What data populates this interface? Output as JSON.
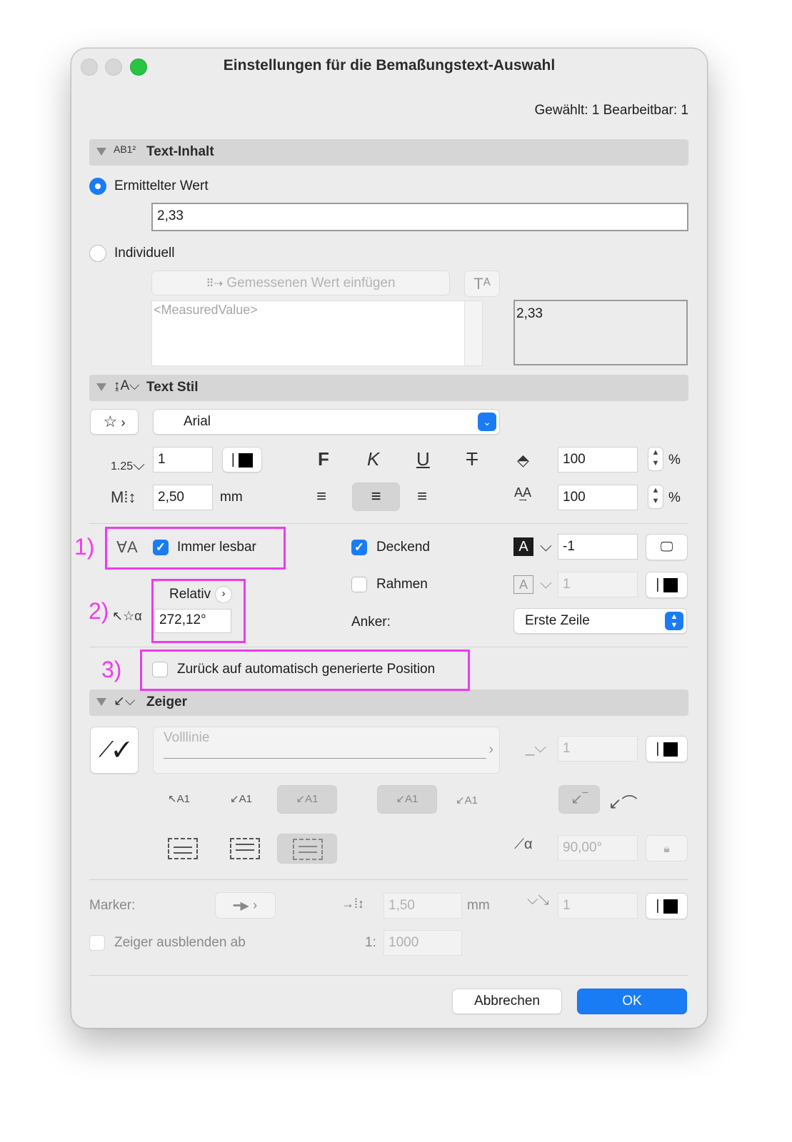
{
  "window": {
    "title": "Einstellungen für die Bemaßungstext-Auswahl",
    "status": "Gewählt: 1 Bearbeitbar: 1"
  },
  "text_inhalt": {
    "section_title": "Text-Inhalt",
    "icon_label": "AB1²",
    "option_measured": "Ermittelter Wert",
    "measured_value": "2,33",
    "option_custom": "Individuell",
    "insert_button": "Gemessenen Wert einfügen",
    "insert_button_icon": "⠿⇢",
    "text_button": "Tᴬ",
    "custom_placeholder": "<MeasuredValue>",
    "preview": "2,33"
  },
  "text_stil": {
    "section_title": "Text Stil",
    "font": "Arial",
    "pen_prefix": "1.25",
    "pen": "1",
    "size": "2,50",
    "size_unit": "mm",
    "bold": "F",
    "italic": "K",
    "underline": "U",
    "strike": "T",
    "width_pct": "100",
    "spacing_pct": "100",
    "pct": "%",
    "always_readable": "Immer lesbar",
    "opaque": "Deckend",
    "frame": "Rahmen",
    "background_pen": "-1",
    "frame_pen": "1",
    "relative": "Relativ",
    "angle": "272,12°",
    "anchor_label": "Anker:",
    "anchor_value": "Erste Zeile",
    "reset_position": "Zurück auf automatisch generierte Position",
    "marker_1": "1)",
    "marker_2": "2)",
    "marker_3": "3)"
  },
  "zeiger": {
    "section_title": "Zeiger",
    "line_type": "Volllinie",
    "pen": "1",
    "angle": "90,00°",
    "alpha": "α",
    "marker_label": "Marker:",
    "marker_size": "1,50",
    "marker_unit": "mm",
    "marker_pen": "1",
    "hide_label": "Zeiger ausblenden ab",
    "scale_prefix": "1:",
    "scale": "1000",
    "leader_a1": "A1"
  },
  "buttons": {
    "cancel": "Abbrechen",
    "ok": "OK"
  },
  "colors": {
    "accent": "#1a7cf5",
    "highlight": "#ee3bee",
    "close": "#d7d7d7",
    "green": "#29c441"
  }
}
